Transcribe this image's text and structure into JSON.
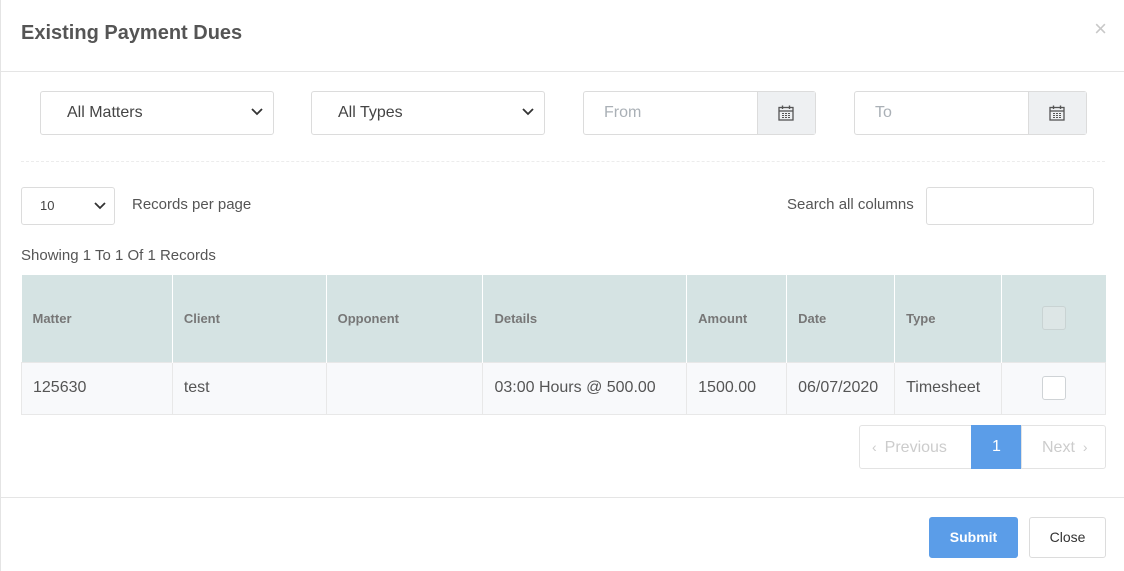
{
  "modal": {
    "title": "Existing Payment Dues",
    "close_glyph": "×"
  },
  "filters": {
    "matters": "All Matters",
    "types": "All Types",
    "from_placeholder": "From",
    "to_placeholder": "To"
  },
  "table_controls": {
    "per_page_value": "10",
    "per_page_label": "Records per page",
    "search_label": "Search all columns",
    "showing": "Showing 1 To 1 Of 1 Records"
  },
  "table": {
    "headers": [
      "Matter",
      "Client",
      "Opponent",
      "Details",
      "Amount",
      "Date",
      "Type"
    ],
    "rows": [
      [
        "125630",
        "test",
        "",
        "03:00 Hours @ 500.00",
        "1500.00",
        "06/07/2020",
        "Timesheet"
      ]
    ]
  },
  "pagination": {
    "previous": "Previous",
    "current": "1",
    "next": "Next"
  },
  "footer": {
    "submit": "Submit",
    "close": "Close"
  },
  "colors": {
    "accent": "#5b9de8",
    "header_bg": "#d5e3e3"
  }
}
